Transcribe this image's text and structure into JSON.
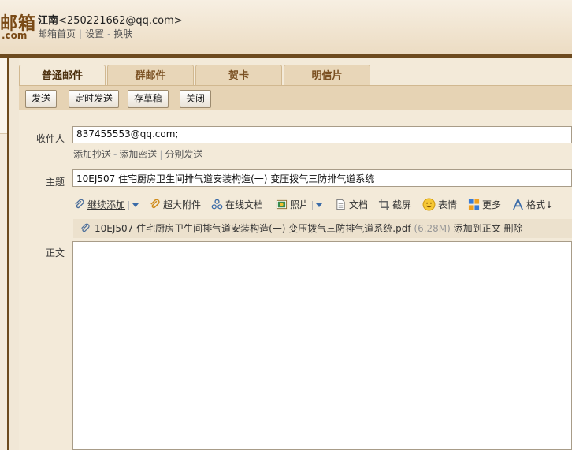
{
  "header": {
    "logo_text": "邮箱",
    "logo_domain": ".com",
    "user_name": "江南",
    "user_email": "<250221662@qq.com>",
    "links": [
      "邮箱首页",
      "设置",
      "换肤"
    ],
    "link_sep": "|",
    "link_dash": "-"
  },
  "tabs": [
    {
      "label": "普通邮件",
      "active": true
    },
    {
      "label": "群邮件",
      "active": false
    },
    {
      "label": "贺卡",
      "active": false
    },
    {
      "label": "明信片",
      "active": false
    }
  ],
  "toolbar": {
    "send": "发送",
    "scheduled_send": "定时发送",
    "save_draft": "存草稿",
    "close": "关闭"
  },
  "recipients": {
    "label": "收件人",
    "value": "837455553@qq.com;",
    "links": [
      "添加抄送",
      "添加密送",
      "分别发送"
    ],
    "dash": "-",
    "sep": "|"
  },
  "subject": {
    "label": "主题",
    "value": "10EJ507 住宅厨房卫生间排气道安装构造(一) 变压拨气三防排气道系统"
  },
  "attach_toolbar": {
    "continue_add": "继续添加",
    "large_attachment": "超大附件",
    "online_doc": "在线文档",
    "photo": "照片",
    "document": "文档",
    "screenshot": "截屏",
    "emoji": "表情",
    "more": "更多",
    "format": "格式↓"
  },
  "attachment": {
    "file_name": "10EJ507 住宅厨房卫生间排气道安装构造(一) 变压拨气三防排气道系统.pdf",
    "size": "(6.28M)",
    "add_to_body": "添加到正文",
    "delete": "删除"
  },
  "body": {
    "label": "正文",
    "value": ""
  },
  "colors": {
    "accent_brown": "#6d4a1e",
    "link_blue": "#3a6ba8"
  }
}
